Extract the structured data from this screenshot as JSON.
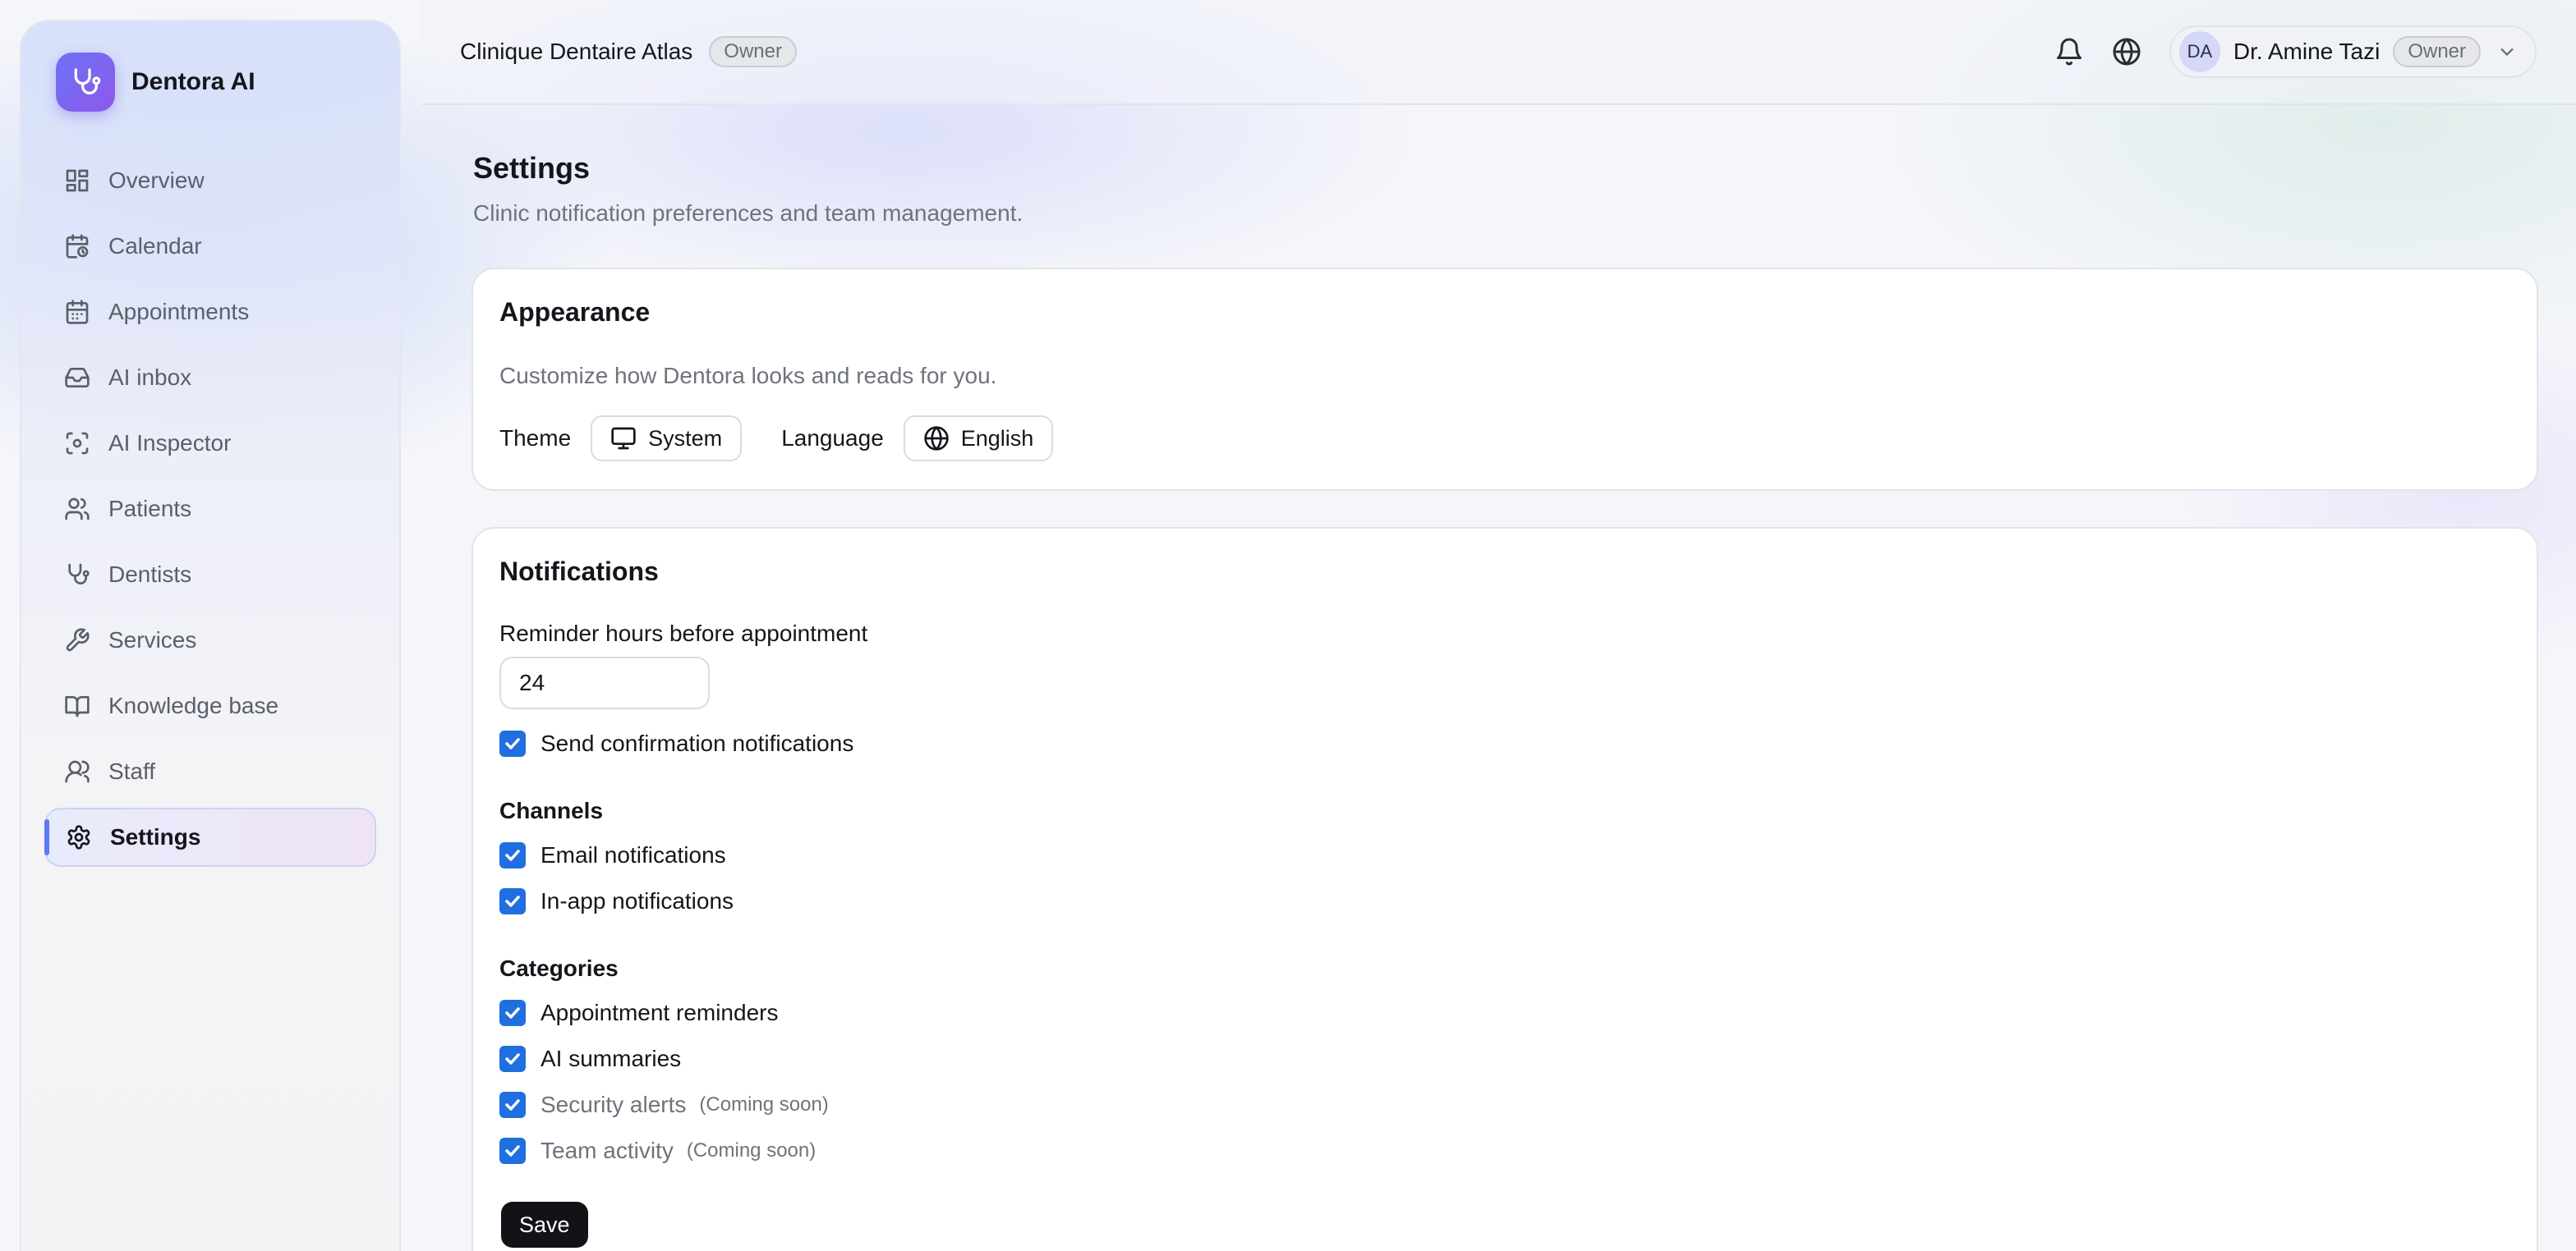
{
  "brand": {
    "name": "Dentora AI"
  },
  "sidebar": {
    "items": [
      {
        "label": "Overview",
        "icon": "overview-icon"
      },
      {
        "label": "Calendar",
        "icon": "calendar-clock-icon"
      },
      {
        "label": "Appointments",
        "icon": "calendar-icon"
      },
      {
        "label": "AI inbox",
        "icon": "inbox-icon"
      },
      {
        "label": "AI Inspector",
        "icon": "scan-face-icon"
      },
      {
        "label": "Patients",
        "icon": "users-icon"
      },
      {
        "label": "Dentists",
        "icon": "stethoscope-icon"
      },
      {
        "label": "Services",
        "icon": "wrench-icon"
      },
      {
        "label": "Knowledge base",
        "icon": "book-icon"
      },
      {
        "label": "Staff",
        "icon": "user-group-icon"
      },
      {
        "label": "Settings",
        "icon": "gear-icon",
        "active": true
      }
    ]
  },
  "header": {
    "clinic_name": "Clinique Dentaire Atlas",
    "clinic_role": "Owner",
    "user": {
      "initials": "DA",
      "name": "Dr. Amine Tazi",
      "role": "Owner"
    }
  },
  "page": {
    "title": "Settings",
    "subtitle": "Clinic notification preferences and team management."
  },
  "appearance": {
    "title": "Appearance",
    "description": "Customize how Dentora looks and reads for you.",
    "theme_label": "Theme",
    "theme_value": "System",
    "language_label": "Language",
    "language_value": "English"
  },
  "notifications": {
    "title": "Notifications",
    "reminder_label": "Reminder hours before appointment",
    "reminder_value": "24",
    "send_confirmation": "Send confirmation notifications",
    "channels_label": "Channels",
    "channels": [
      "Email notifications",
      "In-app notifications"
    ],
    "categories_label": "Categories",
    "categories": [
      {
        "label": "Appointment reminders",
        "badge": ""
      },
      {
        "label": "AI summaries",
        "badge": ""
      },
      {
        "label": "Security alerts",
        "badge": "(Coming soon)"
      },
      {
        "label": "Team activity",
        "badge": "(Coming soon)"
      }
    ],
    "save_label": "Save"
  },
  "colors": {
    "accent": "#1f6fe0",
    "brand": "#7a63f0",
    "primary_button": "#111317"
  }
}
